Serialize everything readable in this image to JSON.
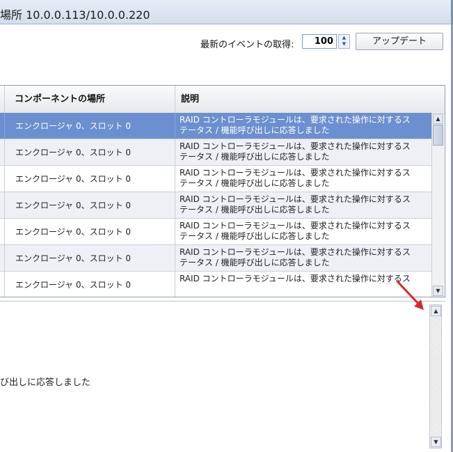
{
  "titlebar": {
    "title": "場所 10.0.0.113/10.0.0.220"
  },
  "toolbar": {
    "fetch_label": "最新のイベントの取得:",
    "count_value": "100",
    "update_label": "アップデート"
  },
  "grid": {
    "columns": [
      "コンポーネントの場所",
      "説明"
    ],
    "rows": [
      {
        "location": "エンクロージャ 0、スロット 0",
        "desc1": "RAID コントローラモジュールは、要求された操作に対するス",
        "desc2": "テータス / 機能呼び出しに応答しました"
      },
      {
        "location": "エンクロージャ 0、スロット 0",
        "desc1": "RAID コントローラモジュールは、要求された操作に対するス",
        "desc2": "テータス / 機能呼び出しに応答しました"
      },
      {
        "location": "エンクロージャ 0、スロット 0",
        "desc1": "RAID コントローラモジュールは、要求された操作に対するス",
        "desc2": "テータス / 機能呼び出しに応答しました"
      },
      {
        "location": "エンクロージャ 0、スロット 0",
        "desc1": "RAID コントローラモジュールは、要求された操作に対するス",
        "desc2": "テータス / 機能呼び出しに応答しました"
      },
      {
        "location": "エンクロージャ 0、スロット 0",
        "desc1": "RAID コントローラモジュールは、要求された操作に対するス",
        "desc2": "テータス / 機能呼び出しに応答しました"
      },
      {
        "location": "エンクロージャ 0、スロット 0",
        "desc1": "RAID コントローラモジュールは、要求された操作に対するス",
        "desc2": "テータス / 機能呼び出しに応答しました"
      },
      {
        "location": "エンクロージャ 0、スロット 0",
        "desc1": "RAID コントローラモジュールは、要求された操作に対するス",
        "desc2": ""
      }
    ],
    "selected_row": 0
  },
  "detail": {
    "text": "び出しに応答しました"
  },
  "icons": {
    "spin_up": "triangle-up",
    "spin_down": "triangle-down",
    "scroll_up": "triangle-up",
    "scroll_down": "triangle-down",
    "annotation": "red-arrow"
  },
  "colors": {
    "selected_row": "#6b8fcf",
    "annotation_arrow": "#d9262b"
  }
}
